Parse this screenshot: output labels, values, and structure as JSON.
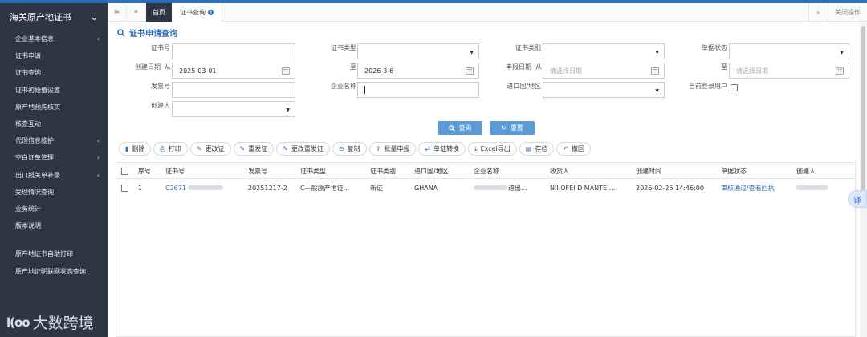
{
  "sidebar": {
    "title": "海关原产地证书",
    "items": [
      {
        "label": "企业基本信息",
        "chevron": true
      },
      {
        "label": "证书申请",
        "chevron": false
      },
      {
        "label": "证书查询",
        "chevron": false
      },
      {
        "label": "证书初始值设置",
        "chevron": false
      },
      {
        "label": "原产地预先核实",
        "chevron": false
      },
      {
        "label": "核查互动",
        "chevron": false
      },
      {
        "label": "代理信息维护",
        "chevron": true
      },
      {
        "label": "空白证单管理",
        "chevron": true
      },
      {
        "label": "出口报关单补录",
        "chevron": true
      },
      {
        "label": "受理情况查询",
        "chevron": false
      },
      {
        "label": "业务统计",
        "chevron": false
      },
      {
        "label": "版本说明",
        "chevron": false
      }
    ],
    "extra_items": [
      {
        "label": "原产地证书自助打印"
      },
      {
        "label": "原产地证明联网状态查询"
      }
    ]
  },
  "watermark": {
    "logo": "l(oo",
    "text": "大数跨境"
  },
  "tabs": {
    "menu_icon": "≡",
    "back_icon": "«",
    "home": "首页",
    "active": "证书查询",
    "forward_icon": "»",
    "close_ops": "关闭操作"
  },
  "page_title": "证书申请查询",
  "form": {
    "cert_no": {
      "label": "证书号",
      "value": ""
    },
    "cert_type": {
      "label": "证书类型",
      "value": ""
    },
    "cert_category": {
      "label": "证书类别",
      "value": ""
    },
    "doc_status": {
      "label": "单据状态",
      "value": ""
    },
    "create_date": {
      "label": "创建日期",
      "from": "从",
      "to": "至",
      "from_value": "2025-03-01",
      "to_value": "2026-3-6"
    },
    "apply_date": {
      "label": "申报日期",
      "from": "从",
      "to": "至",
      "placeholder": "请选择日期"
    },
    "invoice_no": {
      "label": "发票号",
      "value": ""
    },
    "company_name": {
      "label": "企业名称",
      "value": ""
    },
    "country": {
      "label": "进口国/地区",
      "value": ""
    },
    "current_user": {
      "label": "当前登录用户"
    },
    "creator": {
      "label": "创建人",
      "value": ""
    },
    "search_btn": "查询",
    "reset_btn": "重置"
  },
  "toolbar": [
    "删除",
    "打印",
    "更改证",
    "重发证",
    "更改重发证",
    "复制",
    "批量申报",
    "单证转换",
    "Excel导出",
    "存档",
    "撤回"
  ],
  "table": {
    "headers": [
      "序号",
      "证书号",
      "发票号",
      "证书类型",
      "证书类别",
      "进口国/地区",
      "企业名称",
      "收货人",
      "创建时间",
      "单据状态",
      "创建人"
    ],
    "rows": [
      {
        "index": "1",
        "cert_no": "C2671",
        "invoice_no": "20251217-2",
        "cert_type": "C—般原产地证...",
        "cert_category": "新证",
        "country": "GHANA",
        "company_suffix": "进出...",
        "consignee": "NII OFEI D MANTE ...",
        "created": "2026-02-26 14:46:00",
        "status": "审核通过/查看回执"
      }
    ]
  },
  "float_button": "译"
}
